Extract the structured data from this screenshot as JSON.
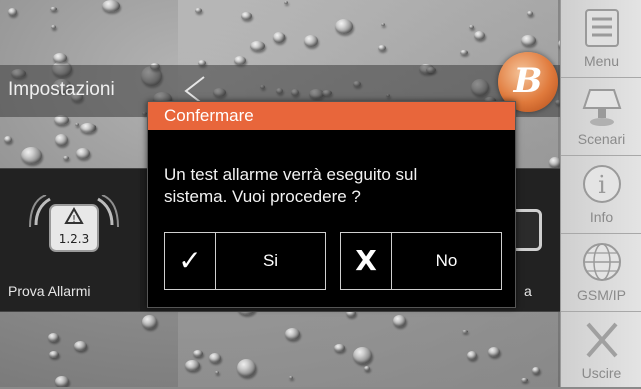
{
  "header": {
    "title": "Impostazioni"
  },
  "tiles": {
    "alarm_test_label": "Prova Allarmi",
    "alarm_icon_text": "1.2.3",
    "right_tile_label_fragment": "a"
  },
  "sidemenu": {
    "items": [
      {
        "label": "Menu",
        "icon": "menu-icon"
      },
      {
        "label": "Scenari",
        "icon": "scenes-icon"
      },
      {
        "label": "Info",
        "icon": "info-icon"
      },
      {
        "label": "GSM/IP",
        "icon": "globe-icon"
      },
      {
        "label": "Uscire",
        "icon": "exit-icon"
      }
    ]
  },
  "dialog": {
    "title": "Confermare",
    "message": "Un test allarme verrà eseguito sul\nsistema.  Vuoi procedere ?",
    "yes_glyph": "✓",
    "yes_label": "Si",
    "no_glyph": "X",
    "no_label": "No"
  },
  "logo": {
    "letter": "B"
  },
  "colors": {
    "accent": "#e8663b",
    "dialog_bg": "#000000",
    "side_menu_text": "#8a8a8a"
  }
}
